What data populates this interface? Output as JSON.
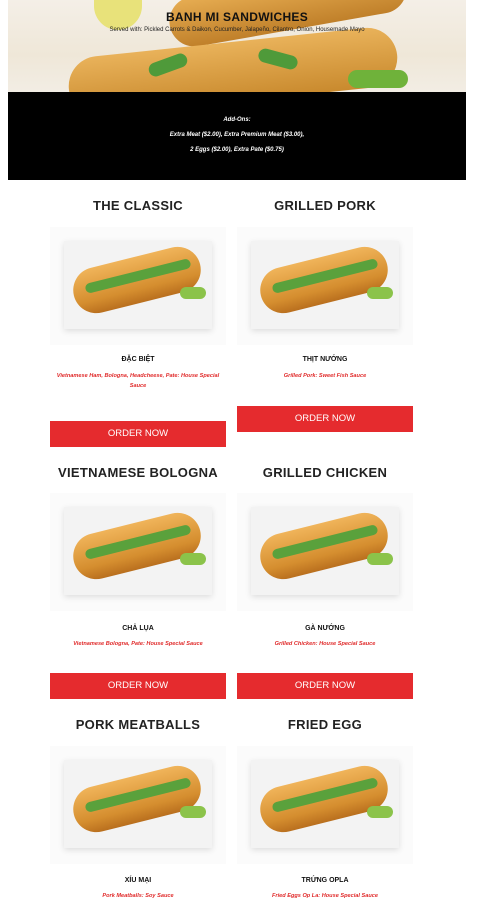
{
  "header": {
    "title": "BANH MI SANDWICHES",
    "subtitle": "Served with: Pickled Carrots & Daikon, Cucumber, Jalapeño, Cilantro, Onion, Housemade Mayo"
  },
  "addons": {
    "heading": "Add-Ons:",
    "line1": "Extra Meat ($2.00), Extra Premium Meat ($3.00),",
    "line2": "2 Eggs ($2.00), Extra Pate ($0.75)"
  },
  "items": [
    {
      "title": "THE CLASSIC",
      "viet_name": "ĐẶC BIỆT",
      "description": "Vietnamese Ham, Bologna, Headcheese, Pate: House Special Sauce",
      "button": "ORDER NOW"
    },
    {
      "title": "GRILLED PORK",
      "viet_name": "THỊT NƯỚNG",
      "description": "Grilled Pork: Sweet Fish Sauce",
      "button": "ORDER NOW"
    },
    {
      "title": "VIETNAMESE BOLOGNA",
      "viet_name": "CHẢ LỤA",
      "description": "Vietnamese Bologna, Pate: House Special Sauce",
      "button": "ORDER NOW"
    },
    {
      "title": "GRILLED CHICKEN",
      "viet_name": "GÀ NƯỚNG",
      "description": "Grilled Chicken: House Special Sauce",
      "button": "ORDER NOW"
    },
    {
      "title": "PORK MEATBALLS",
      "viet_name": "XÍU MẠI",
      "description": "Pork Meatballs: Soy Sauce"
    },
    {
      "title": "FRIED EGG",
      "viet_name": "TRỨNG OPLA",
      "description": "Fried Eggs Op La: House Special Sauce"
    }
  ],
  "colors": {
    "accent": "#e52b2e",
    "desc_text": "#e02a2a",
    "addons_bg": "#000000"
  }
}
